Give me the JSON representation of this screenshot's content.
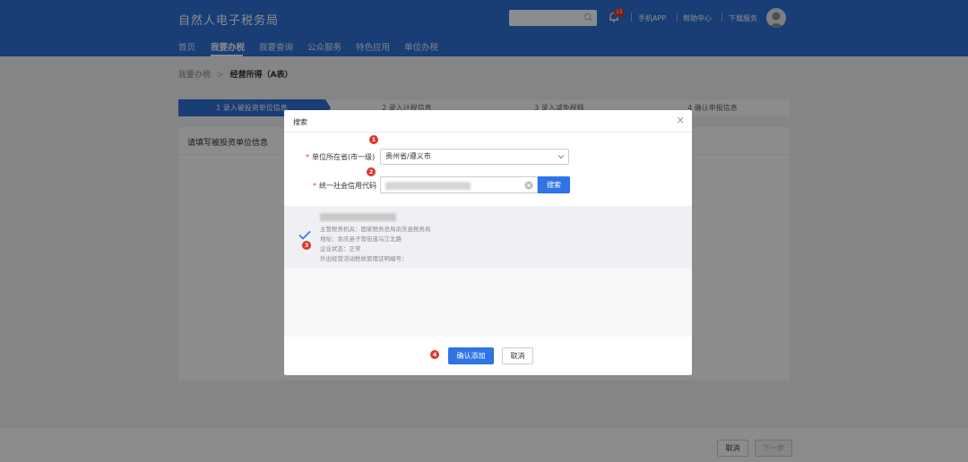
{
  "header": {
    "site_title": "自然人电子税务局",
    "bell_count": "15",
    "links": [
      "手机APP",
      "帮助中心",
      "下载服务"
    ],
    "nav": [
      {
        "label": "首页"
      },
      {
        "label": "我要办税"
      },
      {
        "label": "我要查询"
      },
      {
        "label": "公众服务"
      },
      {
        "label": "特色应用"
      },
      {
        "label": "单位办税"
      }
    ],
    "active_nav": "我要办税"
  },
  "breadcrumb": {
    "parent": "我要办税",
    "current": "经营所得（A表）"
  },
  "steps": [
    {
      "label": "1 录入被投资单位信息",
      "active": true
    },
    {
      "label": "2 录入计税信息",
      "active": false
    },
    {
      "label": "3 录入减免税额",
      "active": false
    },
    {
      "label": "4 确认申报信息",
      "active": false
    }
  ],
  "panel": {
    "title": "请填写被投资单位信息"
  },
  "footer": {
    "cancel_label": "取消",
    "next_label": "下一步"
  },
  "modal": {
    "title": "搜索",
    "close_symbol": "×",
    "province_label": "单位所在省(市一级)",
    "province_value": "贵州省/遵义市",
    "code_label": "统一社会信用代码",
    "search_label": "搜索",
    "result": {
      "tax_authority": "主管税务机关：国家税务总局余庆县税务局",
      "address": "地址：余庆县子营街道乌江北路",
      "status": "企业状态：正常",
      "cert": "外出经营活动税收管理证明编号："
    },
    "confirm_label": "确认添加",
    "cancel_label": "取消",
    "badges": [
      "1",
      "2",
      "3",
      "4"
    ]
  },
  "colors": {
    "primary": "#2e6fd6",
    "button": "#2e74e6",
    "badge": "#e0362c"
  }
}
